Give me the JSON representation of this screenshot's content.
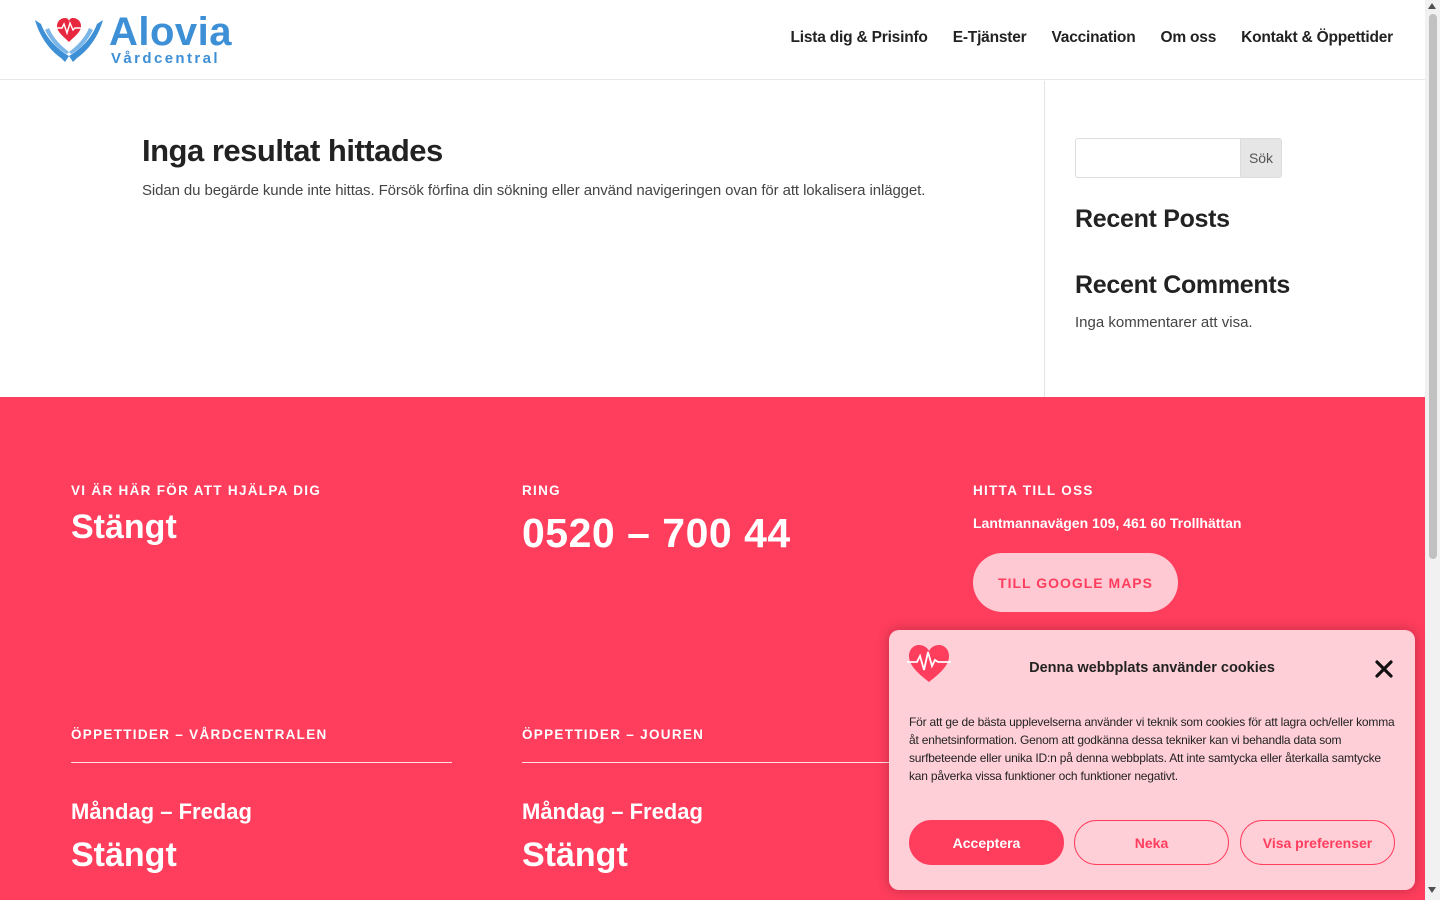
{
  "brand": {
    "name": "Alovia",
    "subtitle": "Vårdcentral",
    "color": "#3d8fd6",
    "accent": "#ff3d5d"
  },
  "nav": {
    "items": [
      {
        "label": "Lista dig & Prisinfo"
      },
      {
        "label": "E-Tjänster"
      },
      {
        "label": "Vaccination"
      },
      {
        "label": "Om oss"
      },
      {
        "label": "Kontakt & Öppettider"
      }
    ]
  },
  "main": {
    "title": "Inga resultat hittades",
    "description": "Sidan du begärde kunde inte hittas. Försök förfina din sökning eller använd navigeringen ovan för att lokalisera inlägget."
  },
  "sidebar": {
    "search_value": "",
    "search_button": "Sök",
    "recent_posts": "Recent Posts",
    "recent_comments": "Recent Comments",
    "no_comments": "Inga kommentarer att visa."
  },
  "footer": {
    "help_label": "VI ÄR HÄR FÖR ATT HJÄLPA DIG",
    "help_status": "Stängt",
    "call_label": "RING",
    "phone": "0520 – 700 44",
    "find_label": "HITTA TILL OSS",
    "address": "Lantmannavägen 109, 461 60 Trollhättan",
    "maps_button": "TILL GOOGLE MAPS",
    "hours_vc_label": "ÖPPETTIDER – VÅRDCENTRALEN",
    "hours_vc_days": "Måndag – Fredag",
    "hours_vc_status": "Stängt",
    "hours_jour_label": "ÖPPETTIDER – JOUREN",
    "hours_jour_days": "Måndag – Fredag",
    "hours_jour_status": "Stängt"
  },
  "cookie": {
    "title": "Denna webbplats använder cookies",
    "text": "För att ge de bästa upplevelserna använder vi teknik som cookies för att lagra och/eller komma åt enhetsinformation. Genom att godkänna dessa tekniker kan vi behandla data som surfbeteende eller unika ID:n på denna webbplats. Att inte samtycka eller återkalla samtycke kan påverka vissa funktioner och funktioner negativt.",
    "accept": "Acceptera",
    "deny": "Neka",
    "preferences": "Visa preferenser"
  },
  "icons": {
    "logo": "hands-heart-icon",
    "cookie_logo": "heart-pulse-icon",
    "close": "close-icon"
  }
}
